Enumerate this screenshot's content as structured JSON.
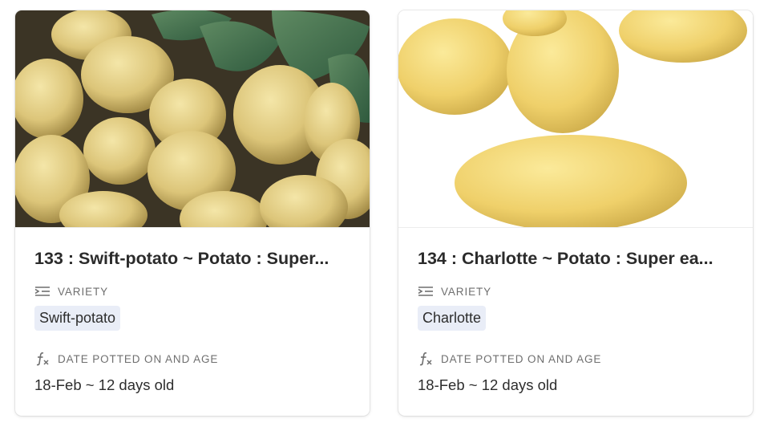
{
  "cards": [
    {
      "title": "133 : Swift-potato ~ Potato : Super...",
      "variety_label": "VARIETY",
      "variety_icon": "variety-list-icon",
      "variety": "Swift-potato",
      "date_label": "DATE POTTED ON AND AGE",
      "date_icon": "formula-icon",
      "date_value": "18-Feb ~ 12 days old"
    },
    {
      "title": "134 : Charlotte ~ Potato : Super ea...",
      "variety_label": "VARIETY",
      "variety_icon": "variety-list-icon",
      "variety": "Charlotte",
      "date_label": "DATE POTTED ON AND AGE",
      "date_icon": "formula-icon",
      "date_value": "18-Feb ~ 12 days old"
    }
  ],
  "colors": {
    "tag_background": "#e9edf7",
    "label_text": "#6f6f6f",
    "title_text": "#2b2b2b"
  }
}
